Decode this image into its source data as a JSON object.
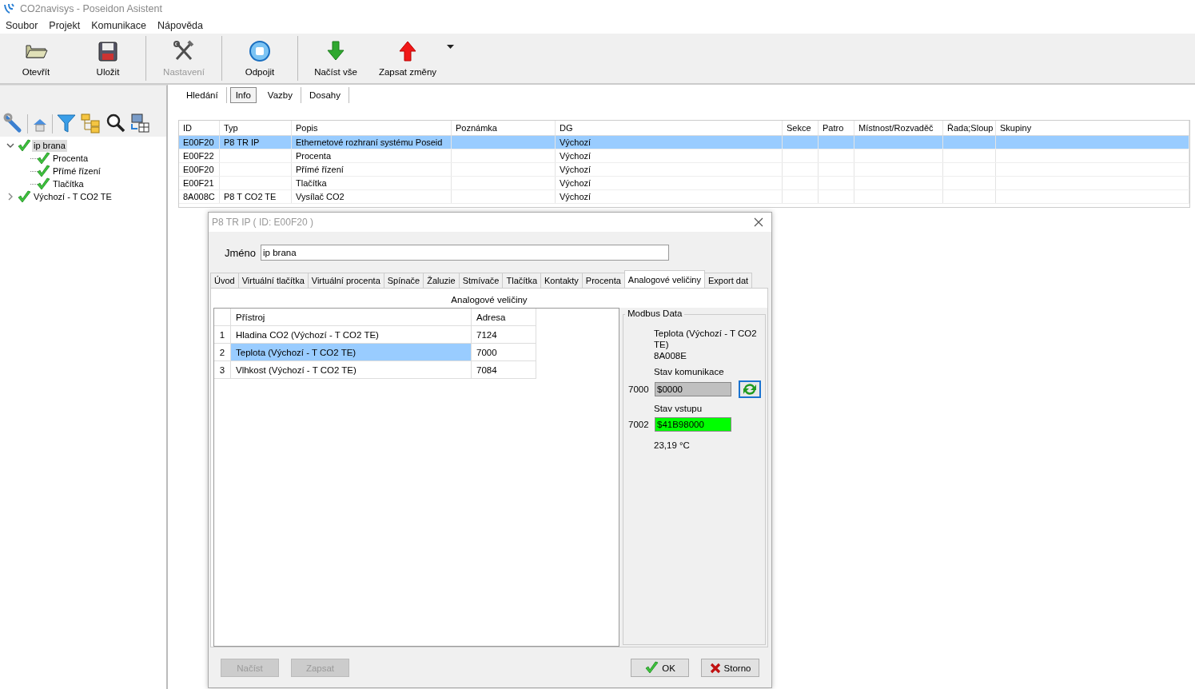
{
  "window": {
    "title": "CO2navisys - Poseidon Asistent"
  },
  "menu": [
    "Soubor",
    "Projekt",
    "Komunikace",
    "Nápověda"
  ],
  "toolbar": [
    {
      "label": "Otevřít",
      "disabled": false
    },
    {
      "label": "Uložit",
      "disabled": false
    },
    {
      "label": "Nastavení",
      "disabled": true
    },
    {
      "label": "Odpojit",
      "disabled": false
    },
    {
      "label": "Načíst vše",
      "disabled": false
    },
    {
      "label": "Zapsat změny",
      "disabled": false
    }
  ],
  "tree": [
    {
      "label": "ip brana",
      "checked": true,
      "selected": true,
      "expanded": true,
      "children": [
        {
          "label": "Procenta",
          "checked": true,
          "selected": false
        },
        {
          "label": "Přímé řízení",
          "checked": true,
          "selected": false
        },
        {
          "label": "Tlačítka",
          "checked": true,
          "selected": false
        }
      ]
    },
    {
      "label": "Výchozí - T CO2 TE",
      "checked": true,
      "selected": false,
      "expanded": false
    }
  ],
  "tabs": [
    {
      "label": "Hledání",
      "selected": false
    },
    {
      "label": "Info",
      "selected": true
    },
    {
      "label": "Vazby",
      "selected": false
    },
    {
      "label": "Dosahy",
      "selected": false
    }
  ],
  "table": {
    "columns": [
      "ID",
      "Typ",
      "Popis",
      "Poznámka",
      "DG",
      "Sekce",
      "Patro",
      "Místnost/Rozvaděč",
      "Řada;Sloup",
      "Skupiny"
    ],
    "rows": [
      {
        "selected": true,
        "cells": [
          "E00F20",
          "P8 TR IP",
          "Ethernetové rozhraní systému Poseid",
          "",
          "Výchozí",
          "",
          "",
          "",
          "",
          ""
        ]
      },
      {
        "selected": false,
        "cells": [
          "E00F22",
          "",
          "Procenta",
          "",
          "Výchozí",
          "",
          "",
          "",
          "",
          ""
        ]
      },
      {
        "selected": false,
        "cells": [
          "E00F20",
          "",
          "Přímé řízení",
          "",
          "Výchozí",
          "",
          "",
          "",
          "",
          ""
        ]
      },
      {
        "selected": false,
        "cells": [
          "E00F21",
          "",
          "Tlačítka",
          "",
          "Výchozí",
          "",
          "",
          "",
          "",
          ""
        ]
      },
      {
        "selected": false,
        "cells": [
          "8A008C",
          "P8 T CO2 TE",
          "Vysílač CO2",
          "",
          "Výchozí",
          "",
          "",
          "",
          "",
          ""
        ]
      }
    ]
  },
  "dialog": {
    "title": "P8 TR IP ( ID: E00F20 )",
    "name_label": "Jméno",
    "name_value": "ip brana",
    "tabs": [
      {
        "label": "Úvod",
        "selected": false
      },
      {
        "label": "Virtuální tlačítka",
        "selected": false
      },
      {
        "label": "Virtuální procenta",
        "selected": false
      },
      {
        "label": "Spínače",
        "selected": false
      },
      {
        "label": "Žaluzie",
        "selected": false
      },
      {
        "label": "Stmívače",
        "selected": false
      },
      {
        "label": "Tlačítka",
        "selected": false
      },
      {
        "label": "Kontakty",
        "selected": false
      },
      {
        "label": "Procenta",
        "selected": false
      },
      {
        "label": "Analogové veličiny",
        "selected": true
      },
      {
        "label": "Export dat",
        "selected": false
      }
    ],
    "heading": "Analogové veličiny",
    "grid": {
      "columns": [
        "Přístroj",
        "Adresa"
      ],
      "rows": [
        {
          "index": "1",
          "device": "Hladina CO2 (Výchozí - T CO2 TE)",
          "address": "7124",
          "selected": false
        },
        {
          "index": "2",
          "device": "Teplota (Výchozí - T CO2 TE)",
          "address": "7000",
          "selected": true
        },
        {
          "index": "3",
          "device": "Vlhkost (Výchozí - T CO2 TE)",
          "address": "7084",
          "selected": false
        }
      ]
    },
    "modbus": {
      "title": "Modbus Data",
      "device": "Teplota (Výchozí - T CO2 TE)",
      "device_id": "8A008E",
      "comm_label": "Stav komunikace",
      "comm_address": "7000",
      "comm_value": "$0000",
      "input_label": "Stav vstupu",
      "input_address": "7002",
      "input_value": "$41B98000",
      "reading": "23,19 °C"
    },
    "buttons": [
      {
        "label": "Načíst",
        "kind": "plain",
        "disabled": true
      },
      {
        "label": "Zapsat",
        "kind": "plain",
        "disabled": true
      },
      {
        "label": "OK",
        "kind": "ok",
        "disabled": false
      },
      {
        "label": "Storno",
        "kind": "cancel",
        "disabled": false
      }
    ]
  }
}
